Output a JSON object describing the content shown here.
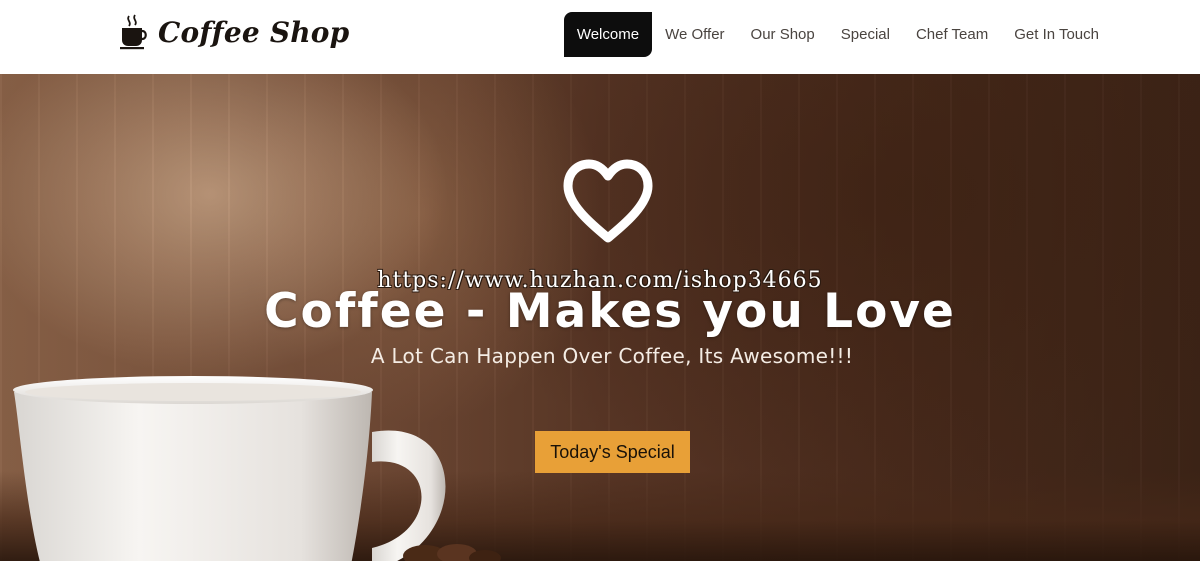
{
  "header": {
    "brand": "Coffee Shop",
    "brand_icon": "coffee-cup-icon",
    "nav": [
      {
        "label": "Welcome",
        "active": true
      },
      {
        "label": "We Offer",
        "active": false
      },
      {
        "label": "Our Shop",
        "active": false
      },
      {
        "label": "Special",
        "active": false
      },
      {
        "label": "Chef Team",
        "active": false
      },
      {
        "label": "Get In Touch",
        "active": false
      }
    ]
  },
  "hero": {
    "icon": "heart-icon",
    "watermark": "https://www.huzhan.com/ishop34665",
    "headline": "Coffee - Makes you Love",
    "subline": "A Lot Can Happen Over Coffee, Its Awesome!!!",
    "cta_label": "Today's Special"
  },
  "colors": {
    "nav_active_bg": "#0d0d0d",
    "cta_bg": "#e8a037",
    "hero_dark": "#3d2417"
  }
}
